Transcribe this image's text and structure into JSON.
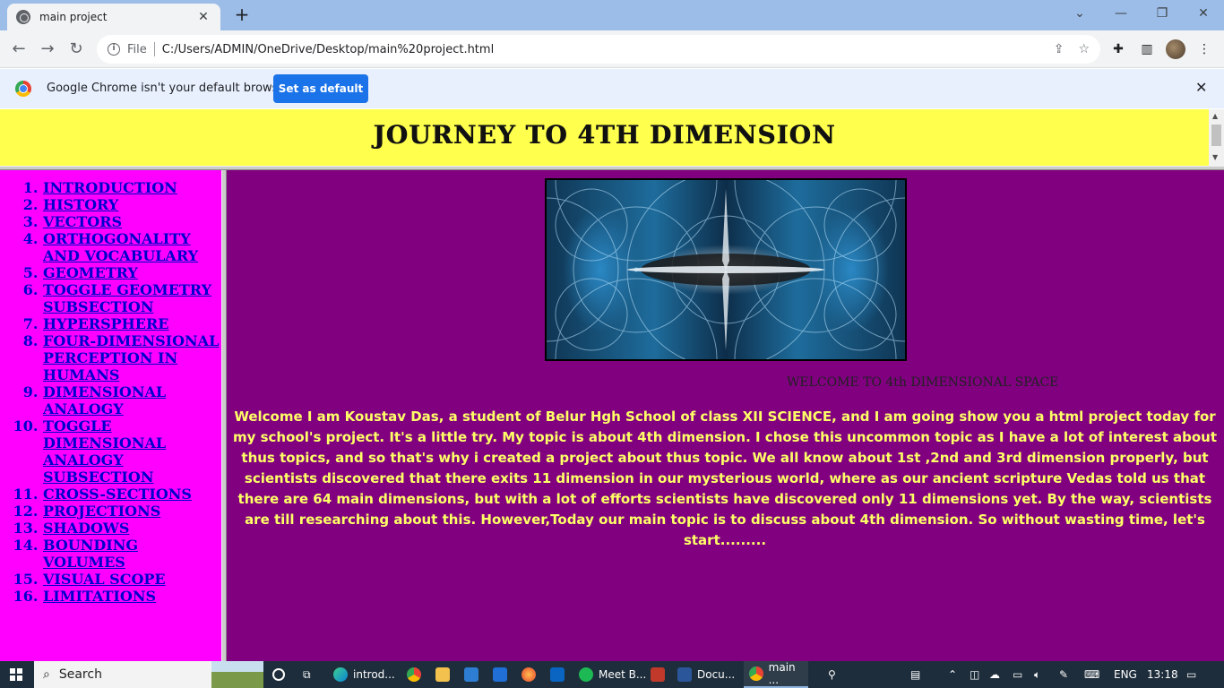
{
  "browser": {
    "tab_title": "main project",
    "tab_close": "✕",
    "new_tab": "+",
    "url_scheme": "File",
    "url": "C:/Users/ADMIN/OneDrive/Desktop/main%20project.html"
  },
  "infobar": {
    "message": "Google Chrome isn't your default browser",
    "button_label": "Set as default",
    "close": "✕"
  },
  "page": {
    "heading": "Journey to 4th Dimension",
    "nav_items": [
      "Introduction",
      "History",
      "Vectors",
      "Orthogonality and vocabulary",
      "Geometry",
      "Toggle Geometry subsection",
      "Hypersphere",
      "Four-dimensional perception in humans",
      "Dimensional analogy",
      "Toggle Dimensional analogy subsection",
      "Cross-sections",
      "Projections",
      "Shadows",
      "Bounding volumes",
      "Visual scope",
      "Limitations"
    ],
    "welcome_title": "WELCOME TO 4th DIMENSIONAL SPACE",
    "intro_text": "Welcome I am Koustav Das, a student of Belur Hgh School of class XII SCIENCE, and I am going show you a html project today for my school's project. It's a little try. My topic is about 4th dimension. I chose this uncommon topic as I have a lot of interest about thus topics, and so that's why i created a project about thus topic. We all know about 1st ,2nd and 3rd dimension properly, but scientists discovered that there exits 11 dimension in our mysterious world, where as our ancient scripture Vedas told us that there are 64 main dimensions, but with a lot of efforts scientists have discovered only 11 dimensions yet. By the way, scientists are till researching about this. However,Today our main topic is to discuss about 4th dimension. So without wasting time, let's start........."
  },
  "taskbar": {
    "search_placeholder": "Search",
    "items": [
      "introd...",
      "Meet B...",
      "Docu...",
      "main ..."
    ],
    "language": "ENG",
    "time": "13:18"
  },
  "colors": {
    "header_bg": "#ffff4d",
    "sidebar_bg": "#ff00ff",
    "main_bg": "#800080",
    "link": "#0000cc",
    "intro_text": "#ffff66"
  }
}
